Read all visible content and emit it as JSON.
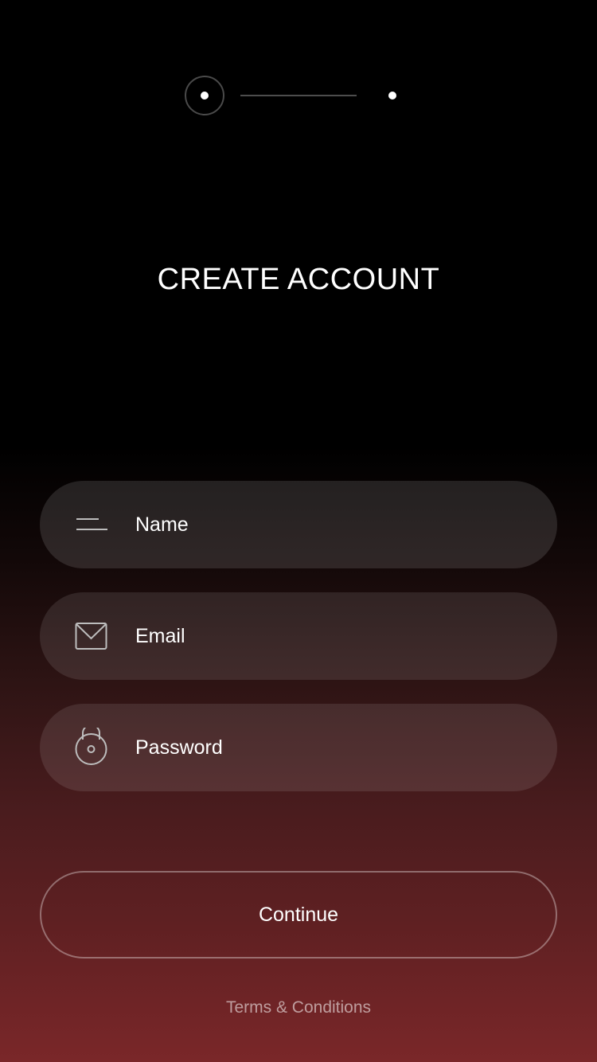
{
  "stepper": {
    "current_step": 1,
    "total_steps": 2
  },
  "title": "CREATE ACCOUNT",
  "fields": {
    "name": {
      "placeholder": "Name",
      "value": "",
      "icon": "name-lines-icon"
    },
    "email": {
      "placeholder": "Email",
      "value": "",
      "icon": "envelope-icon"
    },
    "password": {
      "placeholder": "Password",
      "value": "",
      "icon": "lock-icon"
    }
  },
  "continue_label": "Continue",
  "terms_label": "Terms & Conditions",
  "colors": {
    "background_top": "#000000",
    "background_bottom": "#7a2729",
    "text": "#ffffff",
    "icon_stroke": "#bdbdbd"
  }
}
